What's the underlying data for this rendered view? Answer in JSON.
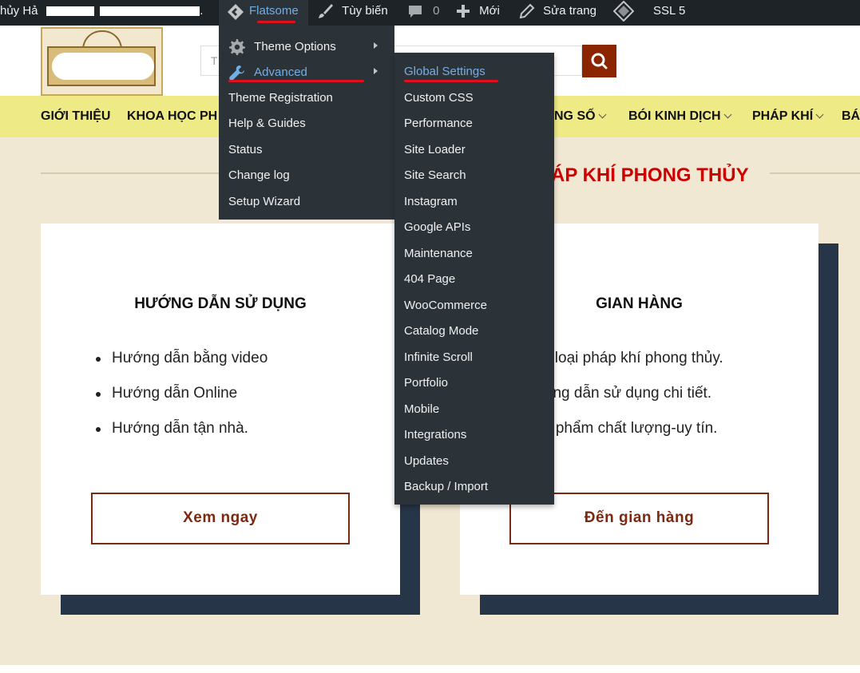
{
  "admin_bar": {
    "site_name": "hủy Hả",
    "site_suffix": "...",
    "flatsome": "Flatsome",
    "customize": "Tùy biến",
    "comments_count": "0",
    "new": "Mới",
    "edit_page": "Sửa trang",
    "ssl": "SSL 5"
  },
  "header": {
    "search_placeholder": "T"
  },
  "nav": {
    "items": [
      "GIỚI THIỆU",
      "KHOA HỌC PH",
      "NG SỐ",
      "BÓI KINH DỊCH",
      "PHÁP KHÍ",
      "BÁ"
    ]
  },
  "section": {
    "title": "ÁP KHÍ PHONG THỦY"
  },
  "card_left": {
    "title": "HƯỚNG DẪN SỬ DỤNG",
    "items": [
      "Hướng dẫn bằng video",
      "Hướng dẫn Online",
      "Hướng dẫn tận nhà."
    ],
    "button": "Xem ngay"
  },
  "card_right": {
    "title": "GIAN HÀNG",
    "items": [
      "c loại pháp khí phong thủy.",
      "ớng dẫn sử dụng chi tiết.",
      "n phẩm chất lượng-uy tín."
    ],
    "button": "Đến gian hàng"
  },
  "flatsome_menu": {
    "items": [
      "Theme Options",
      "Advanced",
      "Theme Registration",
      "Help & Guides",
      "Status",
      "Change log",
      "Setup Wizard"
    ]
  },
  "advanced_menu": {
    "items": [
      "Global Settings",
      "Custom CSS",
      "Performance",
      "Site Loader",
      "Site Search",
      "Instagram",
      "Google APIs",
      "Maintenance",
      "404 Page",
      "WooCommerce",
      "Catalog Mode",
      "Infinite Scroll",
      "Portfolio",
      "Mobile",
      "Integrations",
      "Updates",
      "Backup / Import"
    ]
  },
  "colors": {
    "admin_bar": "#1d2327",
    "menu_bg": "#2c3338",
    "link_active": "#72aee6",
    "nav_bg": "#eeea86",
    "content_bg": "#f1e8d3",
    "section_title": "#cc0000",
    "shadow_block": "#263548",
    "button_border": "#7a2a12",
    "search_button": "#8b2500",
    "annotation": "#e0101c"
  }
}
